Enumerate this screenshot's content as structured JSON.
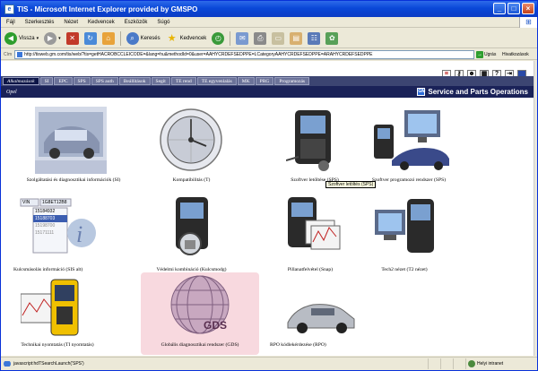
{
  "window": {
    "title": "TIS - Microsoft Internet Explorer provided by GMSPO"
  },
  "menu": [
    "Fájl",
    "Szerkesztés",
    "Nézet",
    "Kedvencek",
    "Eszközök",
    "Súgó"
  ],
  "toolbar": {
    "back": "Vissza",
    "search": "Keresés",
    "favorites": "Kedvencek"
  },
  "address": {
    "label": "Cím",
    "url": "http://tisweb.gm.com/tis/web/?tis=getHACROBCCLEICODE=&lang=hu&methodId=0&user=AAHYCRDEFSEDPPE=LCategoryAAHYCRDEFSEDPPE=ARAHYCRDEFSEDPPE",
    "go": "Ugrás",
    "links": "Hivatkozások"
  },
  "tabs": [
    "Alkalmazások",
    "SI",
    "EPC",
    "SPS",
    "SPS auth",
    "Beállítások",
    "Segít",
    "TE rend",
    "TE egyvenlalás",
    "MK",
    "PRG",
    "Programozás"
  ],
  "section": {
    "left": "Opel",
    "right": "Service and Parts Operations"
  },
  "tiles": [
    {
      "label": "Szolgáltatási és diagnosztikai információk (SI)"
    },
    {
      "label": "Kompatibilitás (T)"
    },
    {
      "label": "Szoftver letöltése (SPS)"
    },
    {
      "label": "Szoftver programozó rendszer (SPS)"
    },
    {
      "label": "Kulcsmásolás információ (SIS alt)"
    },
    {
      "label": "Védelmi kombináció (Kulcsmodg)"
    },
    {
      "label": "Pillanatfelvétel (Snap)"
    },
    {
      "label": "Tech2 nézet (T2 nézet)"
    },
    {
      "label": "Technikai nyomtatás (TI nyomtatás)"
    },
    {
      "label": "Globális diagnosztikai rendszer (GDS)"
    },
    {
      "label": "RPO kódlekérdezése (RPO)"
    }
  ],
  "tooltip": "Szoftver letöltés (SPS)",
  "gds_text": "GDS",
  "tech_screen": "LEARN TECH 2",
  "keycode": {
    "header": "VIN",
    "col2": "1G8ET12B8",
    "rows": [
      "15184932",
      "15188703",
      "15198700",
      "15171111"
    ]
  },
  "status": {
    "text": "javascript:hdTSearchLaunch('SPS')",
    "zone": "Helyi intranet"
  },
  "colors": {
    "tabbar": "#3c4572",
    "section": "#1a2258",
    "highlight": "#f8d9df"
  }
}
